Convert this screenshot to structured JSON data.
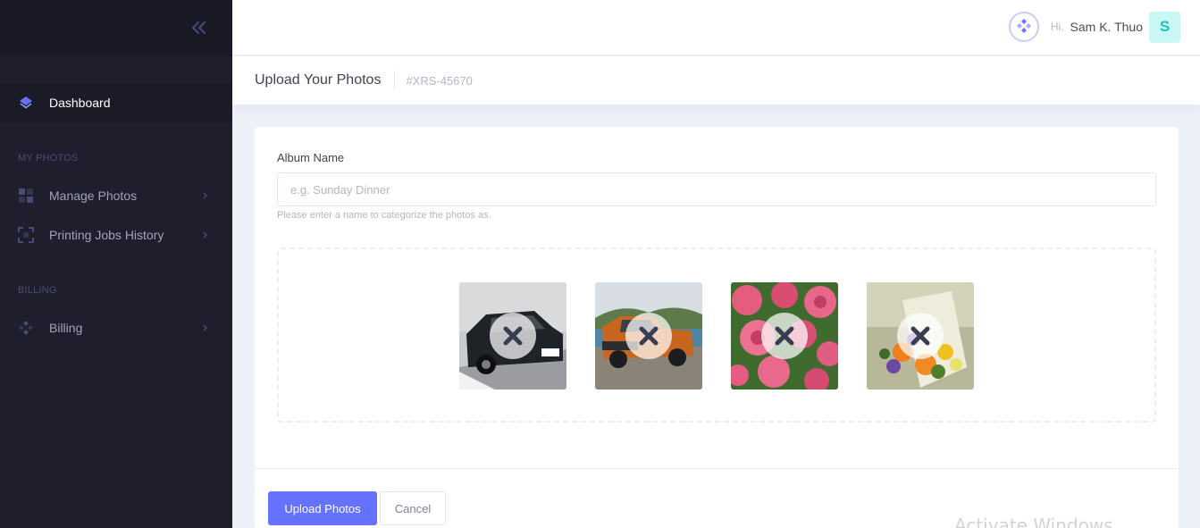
{
  "sidebar": {
    "collapse_icon": "double-chevron-left-icon",
    "dashboard": {
      "label": "Dashboard",
      "icon": "layers-icon"
    },
    "sections": [
      {
        "title": "MY PHOTOS",
        "items": [
          {
            "label": "Manage Photos",
            "icon": "grid-icon"
          },
          {
            "label": "Printing Jobs History",
            "icon": "frame-icon"
          }
        ]
      },
      {
        "title": "BILLING",
        "items": [
          {
            "label": "Billing",
            "icon": "diamond-cluster-icon"
          }
        ]
      }
    ]
  },
  "header": {
    "greeting": "Hi,",
    "user_name": "Sam K. Thuo",
    "avatar_initial": "S"
  },
  "subheader": {
    "title": "Upload Your Photos",
    "reference": "#XRS-45670"
  },
  "form": {
    "album_label": "Album Name",
    "album_placeholder": "e.g. Sunday Dinner",
    "album_value": "",
    "album_hint": "Please enter a name to categorize the photos as."
  },
  "photos": [
    {
      "subject": "black-car",
      "remove_icon": "close-icon"
    },
    {
      "subject": "orange-pickup-truck",
      "remove_icon": "close-icon"
    },
    {
      "subject": "pink-roses",
      "remove_icon": "close-icon"
    },
    {
      "subject": "flower-bouquet",
      "remove_icon": "close-icon"
    }
  ],
  "actions": {
    "upload_label": "Upload Photos",
    "cancel_label": "Cancel"
  },
  "watermark": "Activate Windows",
  "colors": {
    "sidebar_bg": "#1e1e2d",
    "accent": "#6571ff",
    "avatar_bg": "#c9f7f5",
    "avatar_text": "#1bc5bd"
  }
}
